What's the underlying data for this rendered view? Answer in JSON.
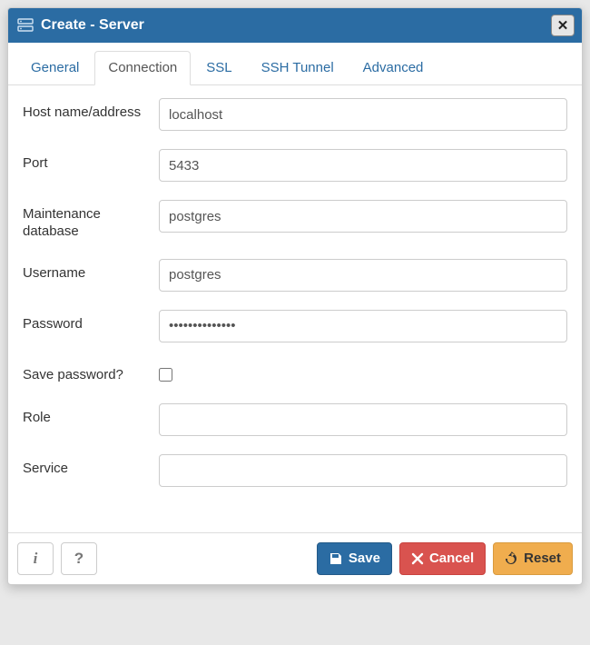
{
  "dialog": {
    "title": "Create - Server"
  },
  "tabs": {
    "general": "General",
    "connection": "Connection",
    "ssl": "SSL",
    "ssh_tunnel": "SSH Tunnel",
    "advanced": "Advanced",
    "active": "connection"
  },
  "form": {
    "host_label": "Host name/address",
    "host_value": "localhost",
    "port_label": "Port",
    "port_value": "5433",
    "maintdb_label": "Maintenance database",
    "maintdb_value": "postgres",
    "username_label": "Username",
    "username_value": "postgres",
    "password_label": "Password",
    "password_value": "••••••••••••••",
    "savepw_label": "Save password?",
    "savepw_checked": false,
    "role_label": "Role",
    "role_value": "",
    "service_label": "Service",
    "service_value": ""
  },
  "footer": {
    "info": "i",
    "help": "?",
    "save": "Save",
    "cancel": "Cancel",
    "reset": "Reset"
  }
}
